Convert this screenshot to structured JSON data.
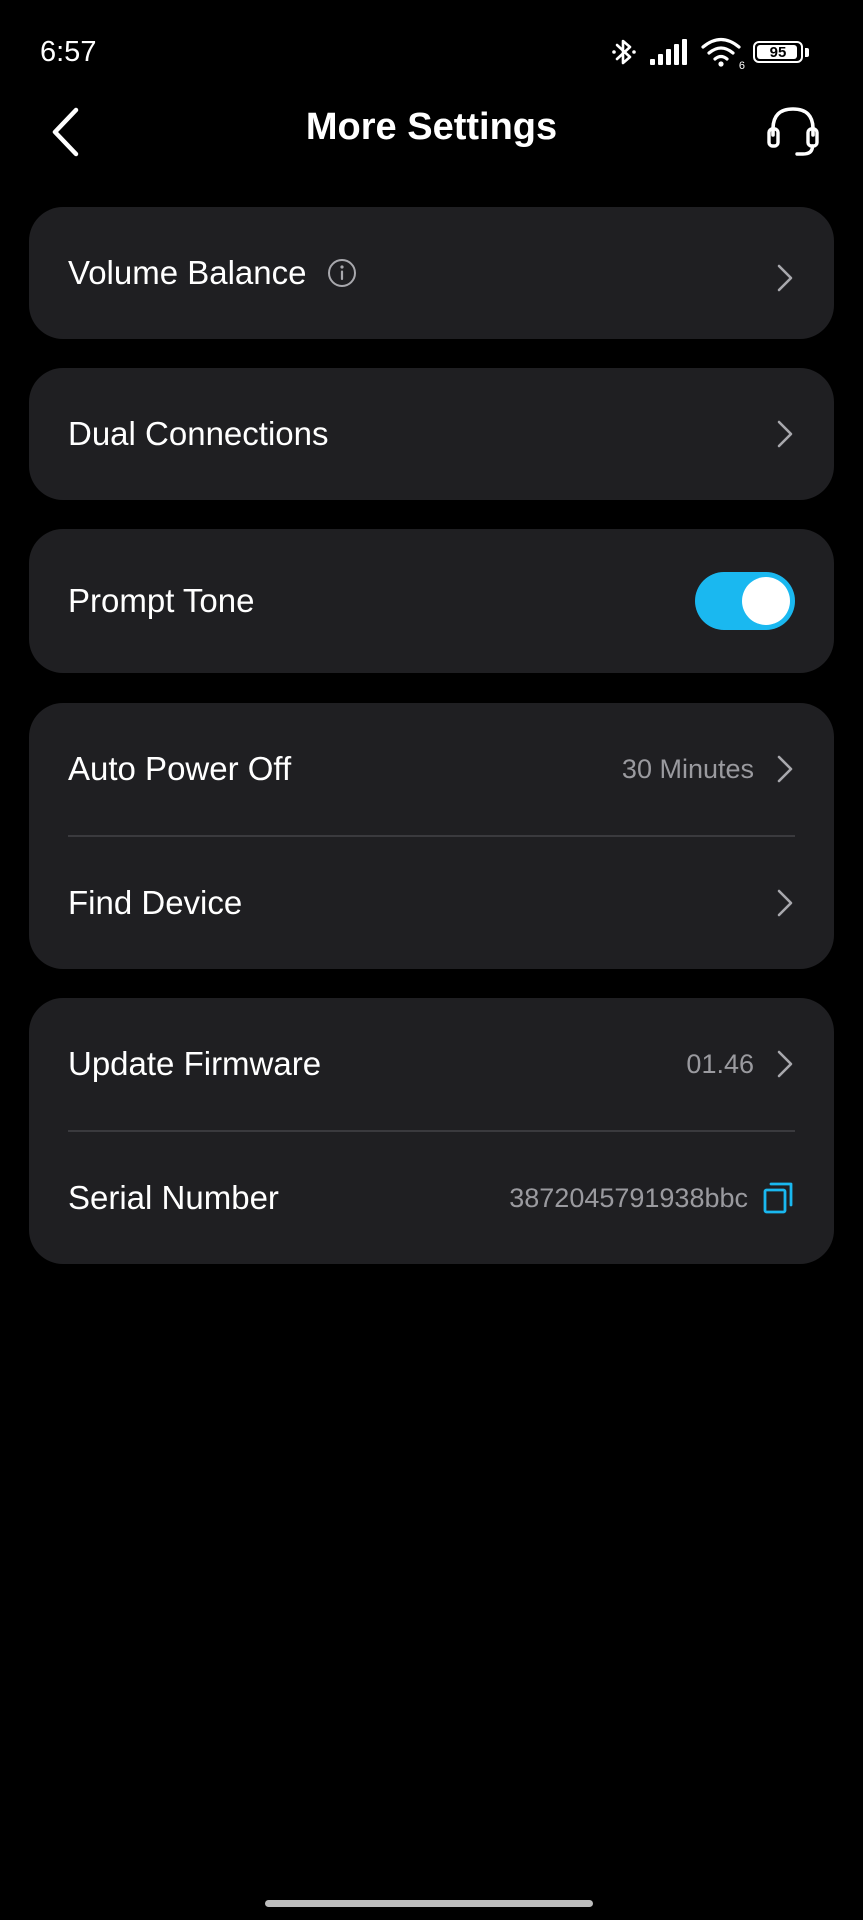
{
  "status_bar": {
    "time": "6:57",
    "battery_level": "95",
    "battery_fraction": 0.95,
    "network_badge": "6",
    "icons": [
      "bluetooth-icon",
      "signal-icon",
      "wifi-icon",
      "battery-icon"
    ]
  },
  "header": {
    "title": "More Settings",
    "back_icon": "chevron-left-icon",
    "support_icon": "headset-icon"
  },
  "settings": {
    "volume_balance": {
      "label": "Volume Balance",
      "info_icon": "info-icon"
    },
    "dual_connections": {
      "label": "Dual Connections"
    },
    "prompt_tone": {
      "label": "Prompt Tone",
      "enabled": true
    },
    "auto_power_off": {
      "label": "Auto Power Off",
      "value": "30 Minutes"
    },
    "find_device": {
      "label": "Find Device"
    },
    "update_firmware": {
      "label": "Update Firmware",
      "value": "01.46"
    },
    "serial_number": {
      "label": "Serial Number",
      "value": "3872045791938bbc",
      "copy_icon": "copy-icon"
    }
  },
  "colors": {
    "background": "#000000",
    "card": "#1f1f22",
    "accent": "#1ab8f0",
    "secondary_text": "#9a9a9f",
    "divider": "#3a3a3e"
  }
}
